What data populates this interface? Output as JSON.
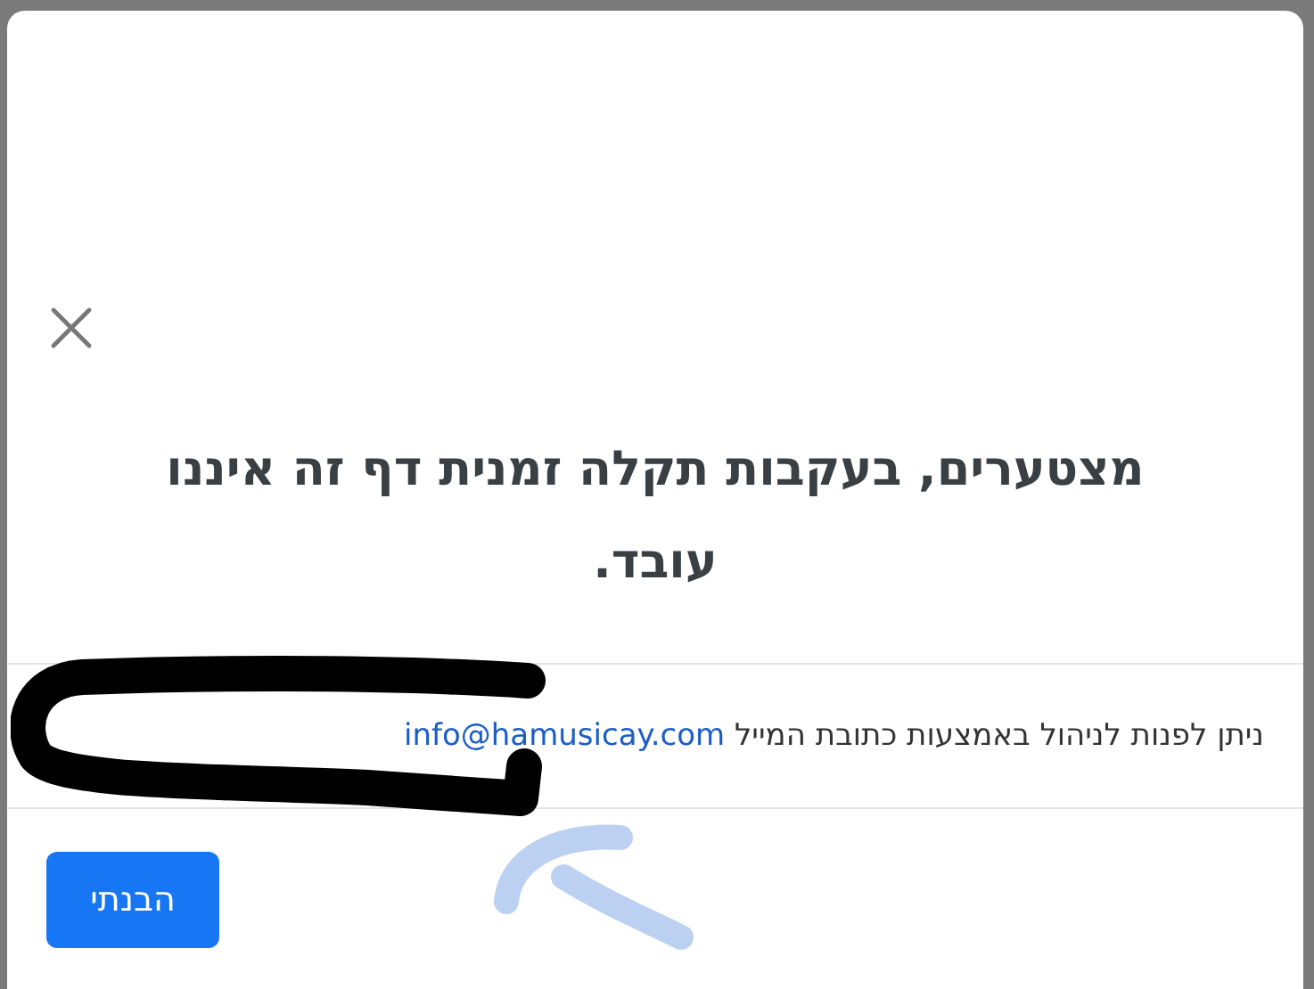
{
  "dialog": {
    "title": "מצטערים, בעקבות תקלה זמנית דף זה איננו עובד.",
    "message": "ניתן לפנות לניהול באמצעות כתובת המייל",
    "email_link": "info@hamusicay.com",
    "buttons": [
      "הבנתי"
    ]
  }
}
